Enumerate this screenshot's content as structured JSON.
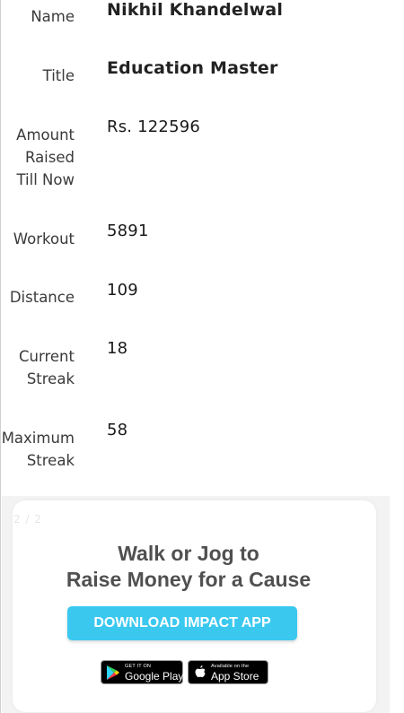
{
  "profile": {
    "rows": [
      {
        "label": "Name",
        "value": "Nikhil Khandelwal"
      },
      {
        "label": "Title",
        "value": "Education Master"
      },
      {
        "label": "Amount Raised Till Now",
        "value": "Rs. 122596"
      },
      {
        "label": "Workout",
        "value": "5891"
      },
      {
        "label": "Distance",
        "value": "109"
      },
      {
        "label": "Current Streak",
        "value": "18"
      },
      {
        "label": "Maximum Streak",
        "value": "58"
      }
    ],
    "amount_label_lines": [
      "Amount",
      "Raised",
      "Till Now"
    ],
    "current_streak_lines": [
      "Current",
      "Streak"
    ],
    "max_streak_lines": [
      "Maximum",
      "Streak"
    ]
  },
  "banner": {
    "pager": "2 / 2",
    "headline_line1": "Walk or Jog to",
    "headline_line2": "Raise Money for a Cause",
    "cta_label": "DOWNLOAD IMPACT APP",
    "google_play": {
      "small": "GET IT ON",
      "big": "Google Play"
    },
    "app_store": {
      "small": "Available on the",
      "big": "App Store"
    },
    "colors": {
      "cta": "#3ac8ef",
      "headline": "#505050"
    }
  }
}
